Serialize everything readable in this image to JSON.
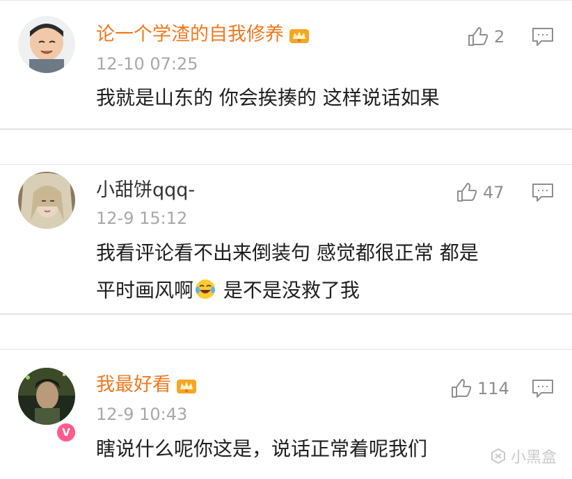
{
  "comments": [
    {
      "username": "论一个学渣的自我修养",
      "time": "12-10 07:25",
      "likes": "2",
      "content": "我就是山东的 你会挨揍的 这样说话如果",
      "vip": true
    },
    {
      "username": "小甜饼qqq-",
      "time": "12-9 15:12",
      "likes": "47",
      "content_line1": "我看评论看不出来倒装句 感觉都很正常 都是",
      "content_line2_a": "平时画风啊",
      "content_line2_b": " 是不是没救了我",
      "vip": false
    },
    {
      "username": "我最好看",
      "time": "12-9 10:43",
      "likes": "114",
      "content": "瞎说什么呢你这是，说话正常着呢我们",
      "vip": true
    }
  ],
  "watermark": "小黑盒",
  "colors": {
    "vip_name": "#f2781e",
    "time": "#a8a8a8",
    "icon": "#8e8e8e"
  },
  "icons": [
    "thumbs-up-icon",
    "comment-icon",
    "crown-icon",
    "laugh-cry-emoji",
    "verified-v-icon"
  ]
}
